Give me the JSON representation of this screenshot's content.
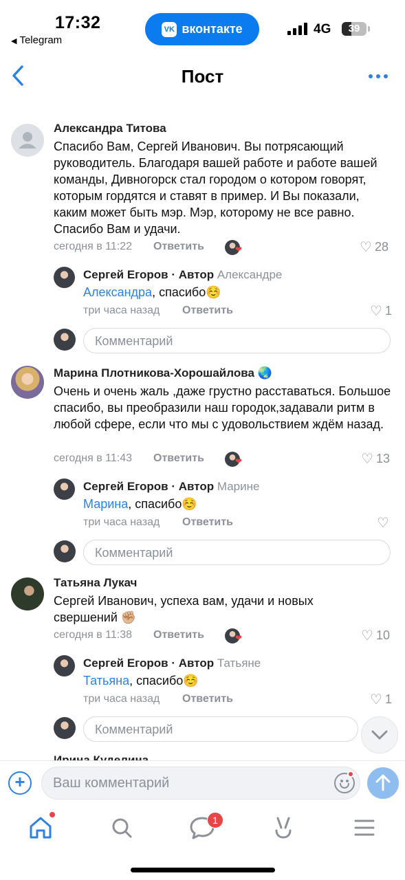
{
  "status_bar": {
    "time": "17:32",
    "back_app": "Telegram",
    "vk_label": "вконтакте",
    "vk_logo": "VK",
    "network": "4G",
    "battery": "39"
  },
  "header": {
    "title": "Пост"
  },
  "comments": [
    {
      "author": "Александра Титова",
      "text": "Спасибо Вам, Сергей Иванович. Вы потрясающий руководитель. Благодаря вашей работе и работе вашей команды, Дивногорск стал городом о котором говорят, которым гордятся и ставят в пример. И Вы показали, каким может быть мэр. Мэр, которому не все равно. Спасибо Вам и удачи.",
      "time": "сегодня в 11:22",
      "reply_label": "Ответить",
      "likes": "28",
      "reply": {
        "author": "Сергей Егоров · Автор",
        "to": "Александре",
        "mention": "Александра",
        "text": ", спасибо☺️",
        "time": "три часа назад",
        "reply_label": "Ответить",
        "likes": "1"
      }
    },
    {
      "author": "Марина Плотникова-Хорошайлова 🌏",
      "text": "Очень  и очень жаль ,даже грустно расставаться. Большое спасибо, вы преобразили наш городок,задавали ритм в любой сфере, если что мы с удовольствием ждём назад.",
      "time": "сегодня в 11:43",
      "reply_label": "Ответить",
      "likes": "13",
      "reply": {
        "author": "Сергей Егоров · Автор",
        "to": "Марине",
        "mention": "Марина",
        "text": ", спасибо☺️",
        "time": "три часа назад",
        "reply_label": "Ответить",
        "likes": ""
      }
    },
    {
      "author": "Татьяна Лукач",
      "text": "Сергей Иванович, успеха вам, удачи и новых свершений ✊🏼",
      "time": "сегодня в 11:38",
      "reply_label": "Ответить",
      "likes": "10",
      "reply": {
        "author": "Сергей Егоров · Автор",
        "to": "Татьяне",
        "mention": "Татьяна",
        "text": ", спасибо☺️",
        "time": "три часа назад",
        "reply_label": "Ответить",
        "likes": "1"
      }
    }
  ],
  "comment_placeholder": "Комментарий",
  "next_comment_author": "Ирина Куделина",
  "input_bar": {
    "placeholder": "Ваш комментарий"
  },
  "tab_bar": {
    "messages_badge": "1"
  },
  "colors": {
    "accent": "#2d81e0",
    "vk_blue": "#0a7cf0",
    "muted": "#8c9198",
    "badge": "#e64646"
  }
}
